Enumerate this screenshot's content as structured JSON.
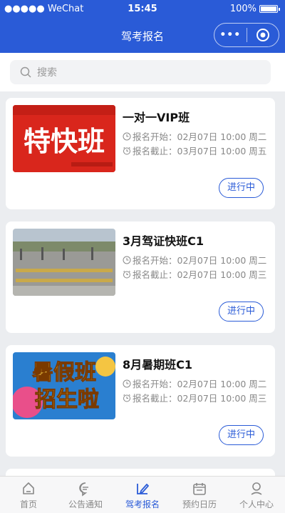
{
  "statusbar": {
    "carrier": "●●●●● WeChat",
    "time": "15:45",
    "battery": "100%"
  },
  "navbar": {
    "title": "驾考报名",
    "menu_dots": "•••"
  },
  "search": {
    "placeholder": "搜索"
  },
  "courses": [
    {
      "title": "一对一VIP班",
      "start": "报名开始：02月07日 10:00 周二",
      "end": "报名截止：03月07日 10:00 周五",
      "status": "进行中"
    },
    {
      "title": "3月驾证快班C1",
      "start": "报名开始：02月07日 10:00 周二",
      "end": "报名截止：02月07日 10:00 周三",
      "status": "进行中"
    },
    {
      "title": "8月暑期班C1",
      "start": "报名开始：02月07日 10:00 周二",
      "end": "报名截止：02月07日 10:00 周三",
      "status": "进行中"
    }
  ],
  "images": [
    {
      "text": "特快班",
      "bg": "#d9261c"
    },
    {
      "bg": "#8e8e8a"
    },
    {
      "text_line1": "暑假班",
      "text_line2": "招生啦",
      "bg": "#2a7fd0"
    }
  ],
  "tabbar": {
    "items": [
      {
        "label": "首页",
        "icon": "home-icon"
      },
      {
        "label": "公告通知",
        "icon": "message-icon"
      },
      {
        "label": "驾考报名",
        "icon": "edit-icon",
        "active": true
      },
      {
        "label": "预约日历",
        "icon": "calendar-icon"
      },
      {
        "label": "个人中心",
        "icon": "user-icon"
      }
    ]
  },
  "colors": {
    "primary": "#2a5bd7",
    "background": "#ebedf0"
  }
}
